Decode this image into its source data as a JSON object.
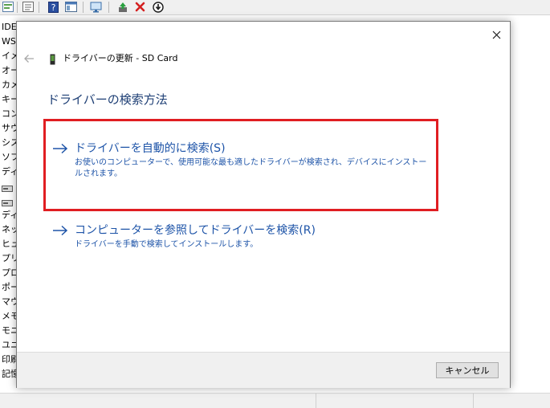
{
  "background": {
    "tree_items": [
      "IDE",
      "WS",
      "イメ",
      "オー",
      "カメ",
      "キー",
      "コン",
      "サウ",
      "シス",
      "ソフ",
      "ディ",
      "",
      "",
      "ディ",
      "ネッ",
      "ヒュ",
      "プリ",
      "プロ",
      "ポー",
      "マウ",
      "メモ",
      "モニ",
      "ユニ",
      "印刷",
      "記憶"
    ]
  },
  "dialog": {
    "title": "ドライバーの更新 - SD Card",
    "heading": "ドライバーの検索方法",
    "options": [
      {
        "title": "ドライバーを自動的に検索(S)",
        "description": "お使いのコンピューターで、使用可能な最も適したドライバーが検索され、デバイスにインストールされます。"
      },
      {
        "title": "コンピューターを参照してドライバーを検索(R)",
        "description": "ドライバーを手動で検索してインストールします。"
      }
    ],
    "cancel_label": "キャンセル"
  },
  "colors": {
    "link_blue": "#1e54a8",
    "heading_blue": "#1e3f75",
    "highlight_red": "#e01e22"
  },
  "icons": {
    "close": "close-icon",
    "back": "back-arrow-icon",
    "option_arrow": "right-arrow-icon"
  }
}
